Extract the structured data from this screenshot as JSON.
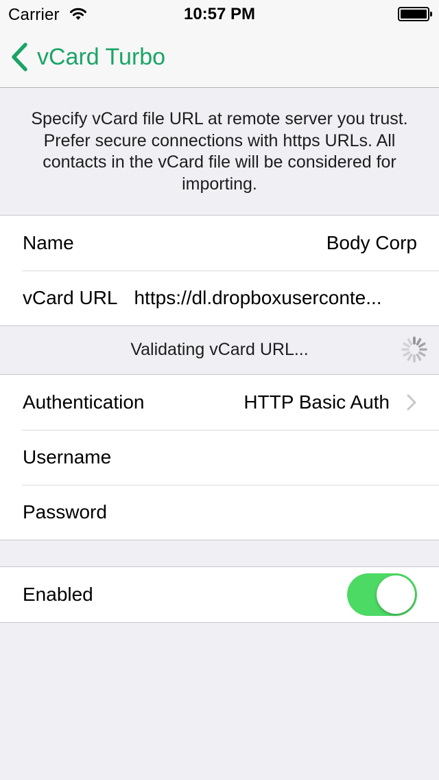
{
  "status_bar": {
    "carrier": "Carrier",
    "time": "10:57 PM"
  },
  "nav": {
    "back_label": "vCard Turbo",
    "accent_color": "#1aa466"
  },
  "description": "Specify vCard file URL at remote server you trust. Prefer secure connections with https URLs. All contacts in the vCard file will be considered for importing.",
  "source_group": {
    "name_label": "Name",
    "name_value": "Body Corp",
    "url_label": "vCard URL",
    "url_value": "https://dl.dropboxuserconte..."
  },
  "validation": {
    "text": "Validating vCard URL..."
  },
  "auth_group": {
    "auth_label": "Authentication",
    "auth_value": "HTTP Basic Auth",
    "username_label": "Username",
    "username_value": "",
    "password_label": "Password",
    "password_value": ""
  },
  "enabled_group": {
    "enabled_label": "Enabled",
    "enabled": true,
    "toggle_color": "#4cd964"
  }
}
